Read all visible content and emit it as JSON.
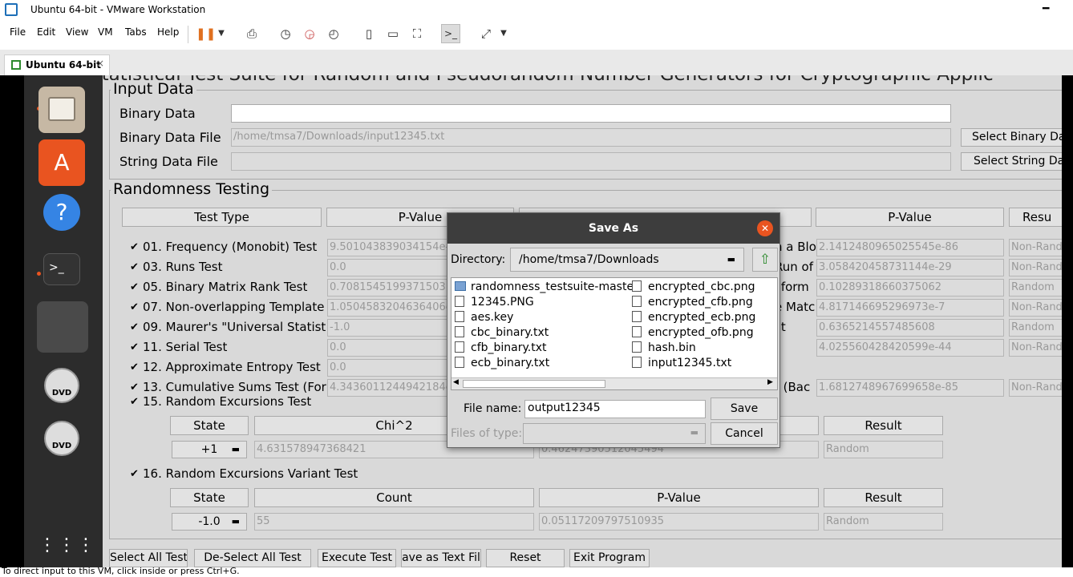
{
  "window": {
    "title": "Ubuntu 64-bit - VMware Workstation"
  },
  "menu": {
    "items": [
      "File",
      "Edit",
      "View",
      "VM",
      "Tabs",
      "Help"
    ]
  },
  "tab": {
    "label": "Ubuntu 64-bit"
  },
  "app": {
    "title_partial": "Statistical Test Suite for Random and Pseudorandom Number Generators for Cryptographic Applic",
    "input": {
      "legend": "Input Data",
      "binary_data_label": "Binary Data",
      "binary_data_value": "",
      "binary_file_label": "Binary Data File",
      "binary_file_value": "/home/tmsa7/Downloads/input12345.txt",
      "string_file_label": "String Data File",
      "string_file_value": "",
      "select_binary": "Select Binary Dat",
      "select_string": "Select String Dat"
    },
    "testing": {
      "legend": "Randomness Testing",
      "headers": {
        "test_type": "Test Type",
        "p_value": "P-Value",
        "p_value2": "P-Value",
        "result": "Resu"
      },
      "left_tests": [
        {
          "label": "01. Frequency (Monobit) Test",
          "p": "9.501043839034154e-"
        },
        {
          "label": "03. Runs Test",
          "p": "0.0"
        },
        {
          "label": "05. Binary Matrix Rank Test",
          "p": "0.7081545199371503"
        },
        {
          "label": "07. Non-overlapping Template M",
          "p": "1.0504583204636406e"
        },
        {
          "label": "09. Maurer's \"Universal Statisti",
          "p": "-1.0"
        },
        {
          "label": "11. Serial Test",
          "p": "0.0"
        },
        {
          "label": "12. Approximate Entropy Test",
          "p": "0.0"
        },
        {
          "label": "13. Cumulative Sums Test (For",
          "p": "4.3436011244942184e"
        }
      ],
      "right_tests": [
        {
          "label": "n a Blo",
          "p": "2.1412480965025545e-86",
          "r": "Non-Rand"
        },
        {
          "label": "Run of",
          "p": "3.058420458731144e-29",
          "r": "Non-Rand"
        },
        {
          "label": "sform",
          "p": "0.10289318660375062",
          "r": "Random"
        },
        {
          "label": "e Matc",
          "p": "4.817146695296973e-7",
          "r": "Non-Rand"
        },
        {
          "label": "st",
          "p": "0.6365214557485608",
          "r": "Random"
        },
        {
          "label": "",
          "p": "4.025560428420599e-44",
          "r": "Non-Rand"
        },
        {
          "label": "",
          "p": "",
          "r": ""
        },
        {
          "label": "t (Bac",
          "p": "1.6812748967699658e-85",
          "r": "Non-Rand"
        }
      ],
      "excursions": {
        "label": "15. Random Excursions Test",
        "h_state": "State",
        "h_chi": "Chi^2",
        "h_result": "Result",
        "state": "+1",
        "chi": "4.631578947368421",
        "pval": "0.46247390512045494",
        "result": "Random"
      },
      "variant": {
        "label": "16. Random Excursions Variant Test",
        "h_state": "State",
        "h_count": "Count",
        "h_pvalue": "P-Value",
        "h_result": "Result",
        "state": "-1.0",
        "count": "55",
        "pval": "0.05117209797510935",
        "result": "Random"
      }
    },
    "buttons": [
      "Select All Test",
      "De-Select All Test",
      "Execute Test",
      "ave as Text Fil",
      "Reset",
      "Exit Program"
    ]
  },
  "dialog": {
    "title": "Save As",
    "directory_label": "Directory:",
    "directory_value": "/home/tmsa7/Downloads",
    "files_col1": [
      "randomness_testsuite-master",
      "12345.PNG",
      "aes.key",
      "cbc_binary.txt",
      "cfb_binary.txt",
      "ecb_binary.txt"
    ],
    "files_col2": [
      "encrypted_cbc.png",
      "encrypted_cfb.png",
      "encrypted_ecb.png",
      "encrypted_ofb.png",
      "hash.bin",
      "input12345.txt"
    ],
    "filename_label": "File name:",
    "filename_value": "output12345",
    "filetype_label": "Files of type:",
    "save": "Save",
    "cancel": "Cancel"
  },
  "status": {
    "text": "To direct input to this VM, click inside or press Ctrl+G."
  },
  "colors": {
    "accent": "#e95420",
    "dock": "#2c2c2c",
    "titlebar_dialog": "#3d3d3d"
  }
}
